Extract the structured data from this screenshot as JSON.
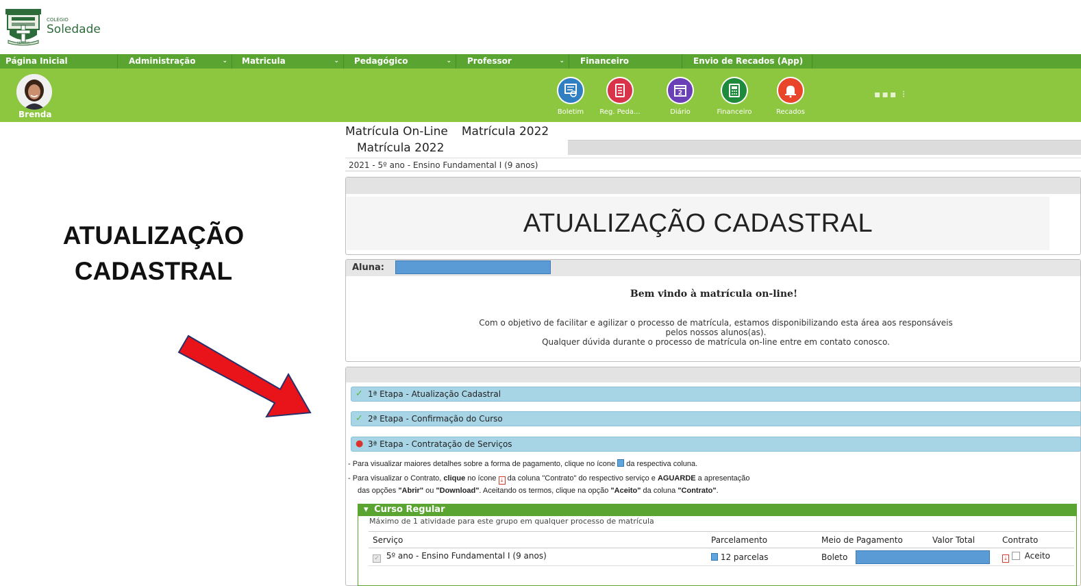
{
  "header": {
    "logo": {
      "small_text": "COLÉGIO",
      "name": "Soledade",
      "motto": "SERVIAM"
    }
  },
  "menu": [
    {
      "label": "Página Inicial",
      "dropdown": false
    },
    {
      "label": "Administração",
      "dropdown": true
    },
    {
      "label": "Matricula",
      "dropdown": true
    },
    {
      "label": "Pedagógico",
      "dropdown": true
    },
    {
      "label": "Professor",
      "dropdown": true
    },
    {
      "label": "Financeiro",
      "dropdown": false
    },
    {
      "label": "Envio de Recados (App)",
      "dropdown": false
    }
  ],
  "user": {
    "name": "Brenda"
  },
  "quick_access": [
    {
      "label": "Boletim",
      "icon": "report-card-icon",
      "color": "#2f7fc1"
    },
    {
      "label": "Reg. Peda...",
      "icon": "notebook-icon",
      "color": "#d9334a"
    },
    {
      "label": "Diário",
      "icon": "calendar-icon",
      "color": "#6b3fb5"
    },
    {
      "label": "Financeiro",
      "icon": "calculator-icon",
      "color": "#1f8a3b"
    },
    {
      "label": "Recados",
      "icon": "bell-icon",
      "color": "#e8452a"
    }
  ],
  "annotation": {
    "line1": "ATUALIZAÇÃO",
    "line2": "CADASTRAL",
    "arrow_color": "#e8141a"
  },
  "main": {
    "title": "Matrícula On-Line",
    "title_suffix": "Matrícula 2022",
    "active_tab": "Matrícula 2022",
    "course_line": "2021 - 5º ano - Ensino Fundamental I (9 anos)",
    "banner": "ATUALIZAÇÃO CADASTRAL",
    "student_label": "Aluna:",
    "welcome_title": "Bem vindo à matrícula on-line!",
    "welcome_line1": "Com o objetivo de facilitar e agilizar o processo de matrícula, estamos disponibilizando esta área aos responsáveis",
    "welcome_line2": "pelos nossos alunos(as).",
    "welcome_line3": "Qualquer dúvida durante o processo de matrícula on-line entre em contato conosco.",
    "steps": [
      {
        "label": "1ª Etapa - Atualização Cadastral",
        "status": "done"
      },
      {
        "label": "2ª Etapa - Confirmação do Curso",
        "status": "done"
      },
      {
        "label": "3ª Etapa - Contratação de Serviços",
        "status": "current"
      }
    ],
    "notes": {
      "n1_a": "- Para visualizar maiores detalhes sobre a forma de pagamento, clique no ícone",
      "n1_b": "da respectiva coluna.",
      "n2_a": "- Para visualizar o Contrato,",
      "n2_bold1": "clique",
      "n2_b": "no ícone",
      "n2_c": "da coluna \"Contrato\" do respectivo serviço e",
      "n2_bold2": "AGUARDE",
      "n2_d": "a apresentação",
      "n3_a": "das opções",
      "n3_bold1": "\"Abrir\"",
      "n3_b": "ou",
      "n3_bold2": "\"Download\"",
      "n3_c": ". Aceitando os termos, clique na opção",
      "n3_bold3": "\"Aceito\"",
      "n3_d": "da coluna",
      "n3_bold4": "\"Contrato\"",
      "n3_e": "."
    },
    "group": {
      "title": "Curso Regular",
      "note": "Máximo de 1 atividade para este grupo em qualquer processo de matrícula",
      "columns": [
        "Serviço",
        "Parcelamento",
        "Meio de Pagamento",
        "Valor Total",
        "Contrato"
      ],
      "row": {
        "service": "5º ano - Ensino Fundamental I (9 anos)",
        "installments": "12 parcelas",
        "payment": "Boleto",
        "accept_label": "Aceito"
      }
    }
  }
}
